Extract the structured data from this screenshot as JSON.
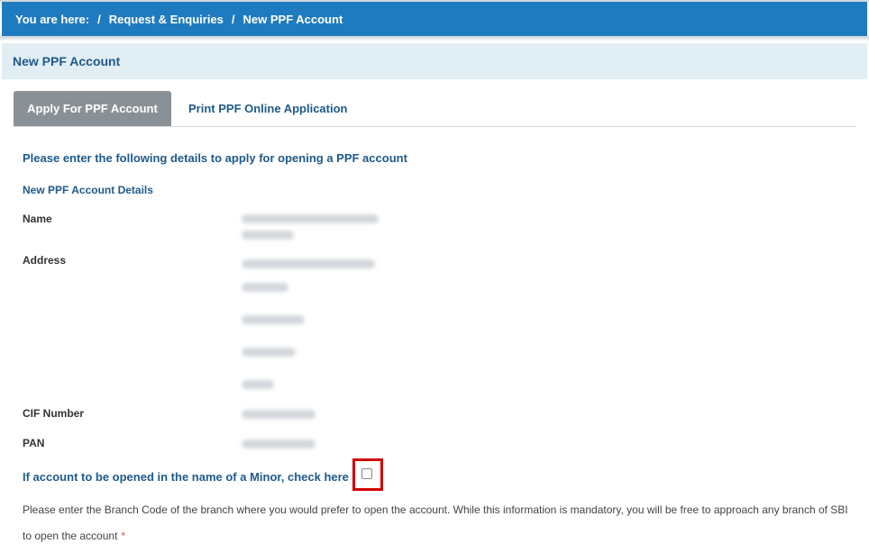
{
  "breadcrumb": {
    "prefix": "You are here:",
    "items": [
      "Request & Enquiries",
      "New PPF Account"
    ]
  },
  "page_title": "New PPF Account",
  "tabs": [
    {
      "label": "Apply For PPF Account",
      "active": true
    },
    {
      "label": "Print PPF Online Application",
      "active": false
    }
  ],
  "intro_text": "Please enter the following details to apply for opening a PPF account",
  "details_title": "New PPF Account Details",
  "fields": {
    "name_label": "Name",
    "address_label": "Address",
    "cif_label": "CIF Number",
    "pan_label": "PAN"
  },
  "minor": {
    "label": "If account to be opened in the name of a Minor, check here",
    "checked": false
  },
  "branch_text": "Please enter the Branch Code of the branch where you would prefer to open the account. While this information is mandatory, you will be free to approach any branch of SBI to open the account",
  "required_mark": "*",
  "colors": {
    "breadcrumb_bg": "#1f7bbf",
    "header_bg": "#e1eef3",
    "accent_text": "#1e5a8a",
    "active_tab_bg": "#8a9196",
    "highlight": "#d40000"
  }
}
